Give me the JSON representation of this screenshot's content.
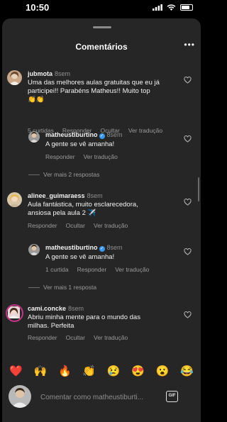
{
  "status": {
    "time": "10:50"
  },
  "sheet": {
    "title": "Comentários",
    "more_label": "•••"
  },
  "comments": [
    {
      "username": "jubmota",
      "time": "8sem",
      "text_line1": "Uma das melhores aulas gratuitas que eu já",
      "text_line2": "participei!! Parabéns Matheus!! Muito top",
      "text_line3": "👏👏",
      "likes": "5 curtidas",
      "reply": "Responder",
      "hide": "Ocultar",
      "translate": "Ver tradução",
      "replies": [
        {
          "username": "matheustiburtino",
          "time": "8sem",
          "text": "A gente se vê amanha!",
          "reply": "Responder",
          "translate": "Ver tradução"
        }
      ],
      "view_more": "Ver mais 2 respostas"
    },
    {
      "username": "alinee_guimaraess",
      "time": "8sem",
      "text_line1": "Aula fantástica, muito esclarecedora,",
      "text_line2": "ansiosa pela aula 2 ✈️",
      "reply": "Responder",
      "hide": "Ocultar",
      "translate": "Ver tradução",
      "replies": [
        {
          "username": "matheustiburtino",
          "time": "8sem",
          "text": "A gente se vê amanha!",
          "likes": "1 curtida",
          "reply": "Responder",
          "translate": "Ver tradução"
        }
      ],
      "view_more": "Ver mais 1 resposta"
    },
    {
      "username": "cami.concke",
      "time": "8sem",
      "text_line1": "Abriu minha mente para o mundo das",
      "text_line2": "milhas. Perfeita",
      "reply": "Responder",
      "hide": "Ocultar",
      "translate": "Ver tradução"
    }
  ],
  "emoji_bar": [
    "❤️",
    "🙌",
    "🔥",
    "👏",
    "😢",
    "😍",
    "😮",
    "😂"
  ],
  "composer": {
    "placeholder": "Comentar como matheustiburti...",
    "gif_label": "GIF"
  },
  "icons": {
    "heart": "heart-outline-icon",
    "verified": "verified-badge-icon",
    "gif": "gif-icon"
  },
  "colors": {
    "sheet_bg": "#262626",
    "muted_text": "#9a9a9a",
    "verified_blue": "#3897f0"
  }
}
